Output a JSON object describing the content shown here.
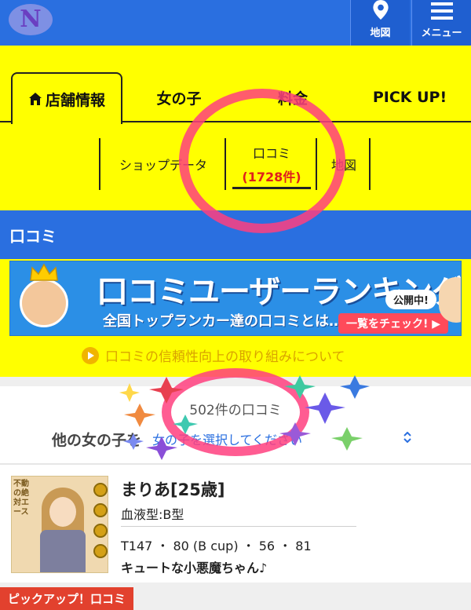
{
  "header": {
    "logo_letter": "N",
    "map_label": "地図",
    "menu_label": "メニュー"
  },
  "tabs": {
    "store_info": "店舗情報",
    "girls": "女の子",
    "price": "料金",
    "pickup": "PICK UP!"
  },
  "subtabs": {
    "shop_data": "ショップデータ",
    "reviews": "口コミ",
    "reviews_count": "(1728件)",
    "map": "地図"
  },
  "section": {
    "title": "口コミ"
  },
  "banner": {
    "title": "口コミユーザーランキング",
    "subtitle": "全国トップランカー達の口コミとは…!?",
    "badge": "公開中!",
    "check": "一覧をチェック! ▶"
  },
  "reliability_text": "口コミの信頼性向上の取り組みについて",
  "review_count_text": "502件の口コミ",
  "filter": {
    "label": "他の女の子を",
    "value": "女の子を選択してください"
  },
  "girl": {
    "name": "まりあ[25歳]",
    "blood": "血液型:B型",
    "size": "T147 ・ 80 (B cup) ・ 56 ・ 81",
    "catch": "キュートな小悪魔ちゃん♪",
    "thumb_caption": "不動の絶対エース"
  },
  "pickup_review_label": "ピックアップ！口コミ",
  "colors": {
    "header_blue": "#2a6fe0",
    "tab_yellow": "#ffff00",
    "count_red": "#e0201c",
    "doodle_pink": "#ff3f7f"
  }
}
